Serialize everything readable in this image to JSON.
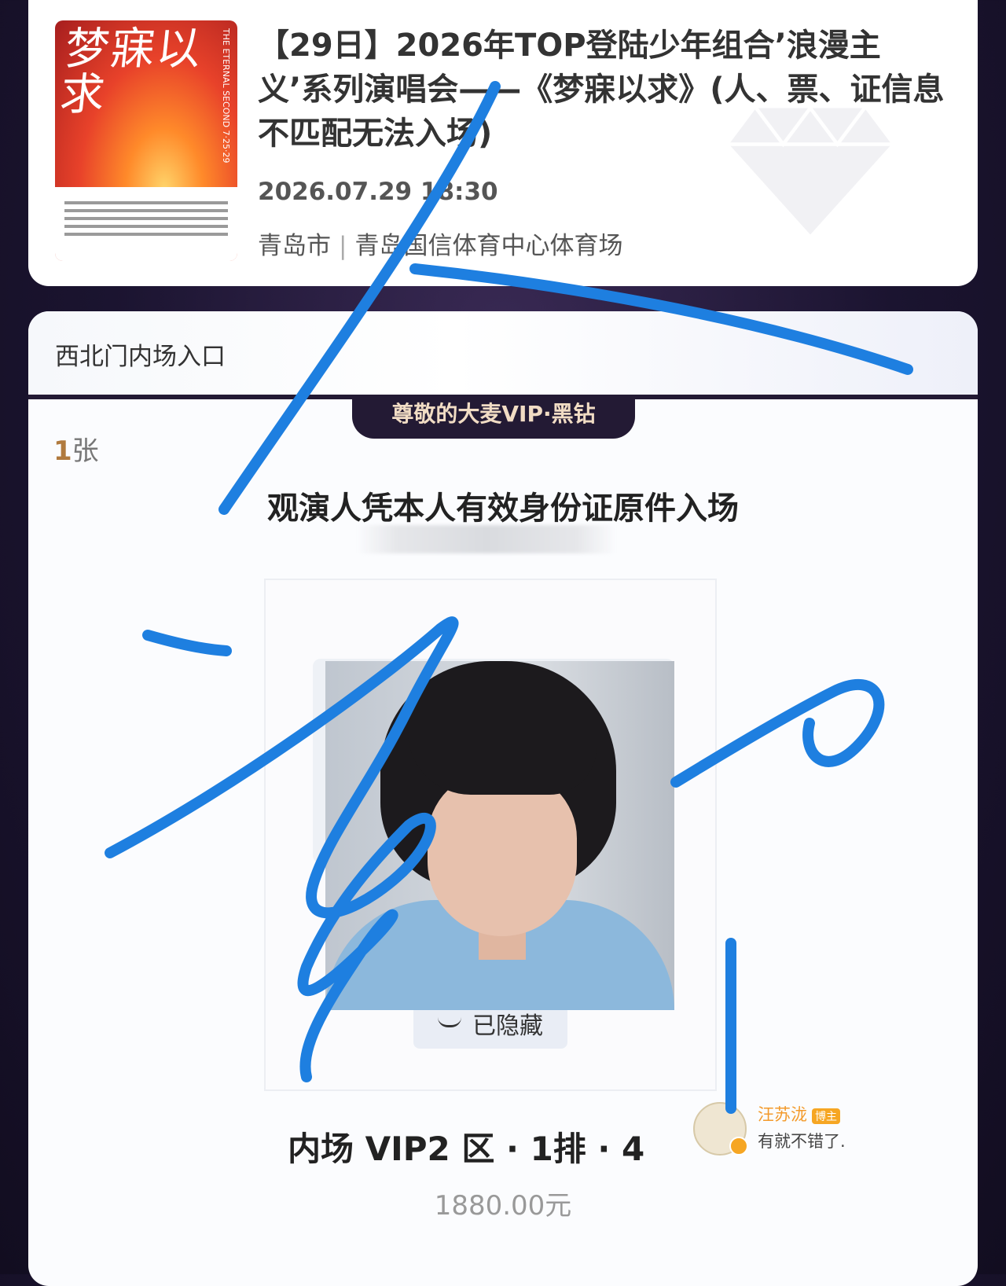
{
  "event": {
    "poster_title": "梦寐以求",
    "poster_side_text": "THE ETERNAL SECOND 7·25·29",
    "title": "【29日】2026年TOP登陆少年组合’浪漫主义’系列演唱会——《梦寐以求》(人、票、证信息不匹配无法入场)",
    "datetime": "2026.07.29 18:30",
    "city": "青岛市",
    "separator": "|",
    "venue": "青岛国信体育中心体育场"
  },
  "ticket": {
    "gate": "西北门内场入口",
    "vip_level": "尊敬的大麦VIP·黑钻",
    "count_number": "1",
    "count_unit": "张",
    "entry_notice": "观演人凭本人有效身份证原件入场",
    "hidden_label": "已隐藏",
    "seat": "内场 VIP2 区 · 1排 · 4",
    "price": "1880.00元"
  },
  "comment": {
    "username": "汪苏泷",
    "tag": "博主",
    "text": "有就不错了."
  },
  "colors": {
    "background": "#1b1430",
    "scribble": "#1e7fe0",
    "vip_tab": "#231a34",
    "accent_count": "#b07a3e"
  }
}
